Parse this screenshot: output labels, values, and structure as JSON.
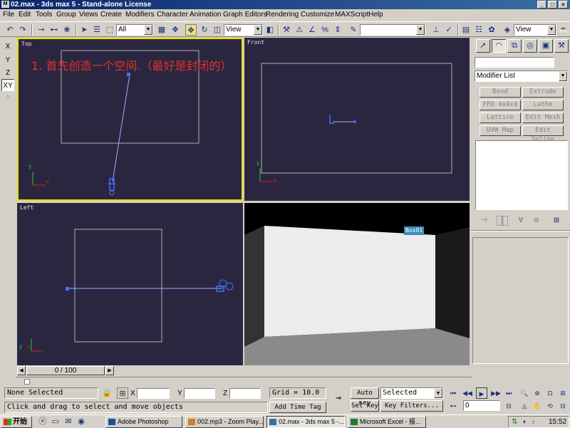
{
  "window": {
    "title": "02.max - 3ds max 5 - Stand-alone License",
    "app_icon": "3ds-max-icon",
    "controls": [
      "_",
      "□",
      "×"
    ]
  },
  "menu": [
    "File",
    "Edit",
    "Tools",
    "Group",
    "Views",
    "Create",
    "Modifiers",
    "Character",
    "Animation",
    "Graph Editors",
    "Rendering",
    "Customize",
    "MAXScript",
    "Help"
  ],
  "toolbar": {
    "selection_filter": "All",
    "reference_coord": "View",
    "named_selection": "",
    "render_view": "View"
  },
  "axis_constraints": [
    "X",
    "Y",
    "Z",
    "XY"
  ],
  "viewports": {
    "top": {
      "label": "Top",
      "annotation": "1. 首先创造一个空间.（最好是封闭的）",
      "axis_x": "x",
      "axis_y": "y"
    },
    "front": {
      "label": "Front",
      "axis_x": "x",
      "axis_y": "z"
    },
    "left": {
      "label": "Left",
      "axis_x": "x",
      "axis_y": "y"
    },
    "perspective": {
      "object_label": "Box01"
    }
  },
  "command_panel": {
    "object_name": "",
    "modifier_list": "Modifier List",
    "modifier_buttons": [
      "Bend",
      "Extrude",
      "FFD 4x4x4",
      "Lathe",
      "Lattice",
      "Edit Mesh",
      "UVW Map",
      "Edit Spline"
    ]
  },
  "timeline": {
    "frame_label": "0 / 100"
  },
  "status": {
    "selection": "None Selected",
    "prompt": "Click and drag to select and move objects",
    "x_label": "X",
    "y_label": "Y",
    "z_label": "Z",
    "x_value": "",
    "y_value": "",
    "z_value": "",
    "grid": "Grid = 10.0",
    "add_time_tag": "Add Time Tag",
    "auto_key": "Auto Key",
    "set_key": "Set Key",
    "key_mode": "Selected",
    "key_filters": "Key Filters...",
    "current_frame": "0"
  },
  "taskbar": {
    "start": "开始",
    "tasks": [
      {
        "label": "Adobe Photoshop",
        "color": "#1a4fa0"
      },
      {
        "label": "002.mp3 - Zoom Play...",
        "color": "#d08020"
      },
      {
        "label": "02.max - 3ds max 5 -...",
        "color": "#3a6ea5"
      },
      {
        "label": "Microsoft Excel - 报...",
        "color": "#1e7a30"
      }
    ],
    "clock": "15:52"
  },
  "colors": {
    "viewport_bg": "#2b2640",
    "active_border": "#e8e000",
    "annotation": "#e0302a",
    "selection": "#4070ff"
  }
}
